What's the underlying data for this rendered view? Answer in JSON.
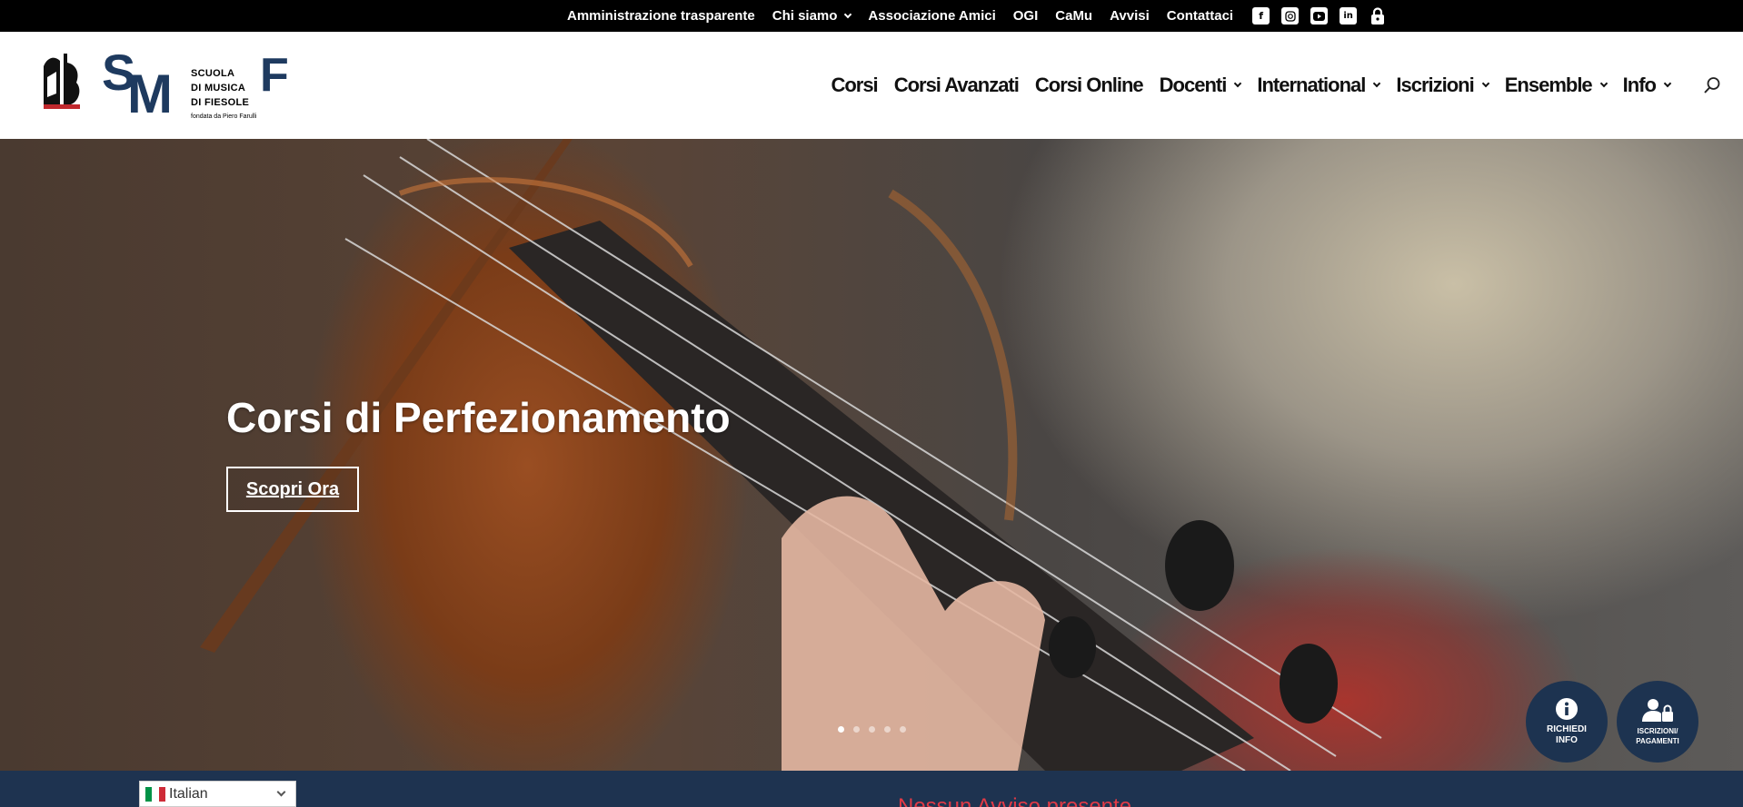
{
  "topbar": {
    "links": [
      {
        "label": "Amministrazione trasparente",
        "dropdown": false
      },
      {
        "label": "Chi siamo",
        "dropdown": true
      },
      {
        "label": "Associazione Amici",
        "dropdown": false
      },
      {
        "label": "OGI",
        "dropdown": false
      },
      {
        "label": "CaMu",
        "dropdown": false
      },
      {
        "label": "Avvisi",
        "dropdown": false
      },
      {
        "label": "Contattaci",
        "dropdown": false
      }
    ],
    "social_icons": [
      "facebook-icon",
      "instagram-icon",
      "youtube-icon",
      "linkedin-icon",
      "lock-icon"
    ]
  },
  "logo": {
    "line1": "SCUOLA",
    "line2": "DI MUSICA",
    "line3": "DI FIESOLE",
    "founded": "fondata da Piero Farulli"
  },
  "mainnav": {
    "items": [
      {
        "label": "Corsi",
        "dropdown": false
      },
      {
        "label": "Corsi Avanzati",
        "dropdown": false
      },
      {
        "label": "Corsi Online",
        "dropdown": false
      },
      {
        "label": "Docenti",
        "dropdown": true
      },
      {
        "label": "International",
        "dropdown": true
      },
      {
        "label": "Iscrizioni",
        "dropdown": true
      },
      {
        "label": "Ensemble",
        "dropdown": true
      },
      {
        "label": "Info",
        "dropdown": true
      }
    ],
    "search_icon": "search-icon"
  },
  "hero": {
    "title": "Corsi di Perfezionamento",
    "button_label": "Scopri Ora",
    "slides_count": 5,
    "active_slide": 1
  },
  "floating": {
    "info_label_1": "RICHIEDI",
    "info_label_2": "INFO",
    "iscr_label_1": "ISCRIZIONI/",
    "iscr_label_2": "PAGAMENTI"
  },
  "footer_strip": {
    "language": "Italian",
    "avvisi_text": "Nessun Avviso presente"
  },
  "colors": {
    "brand_blue": "#1e3a5f",
    "strip_blue": "#1e3350",
    "alert_red": "#e23a46"
  }
}
